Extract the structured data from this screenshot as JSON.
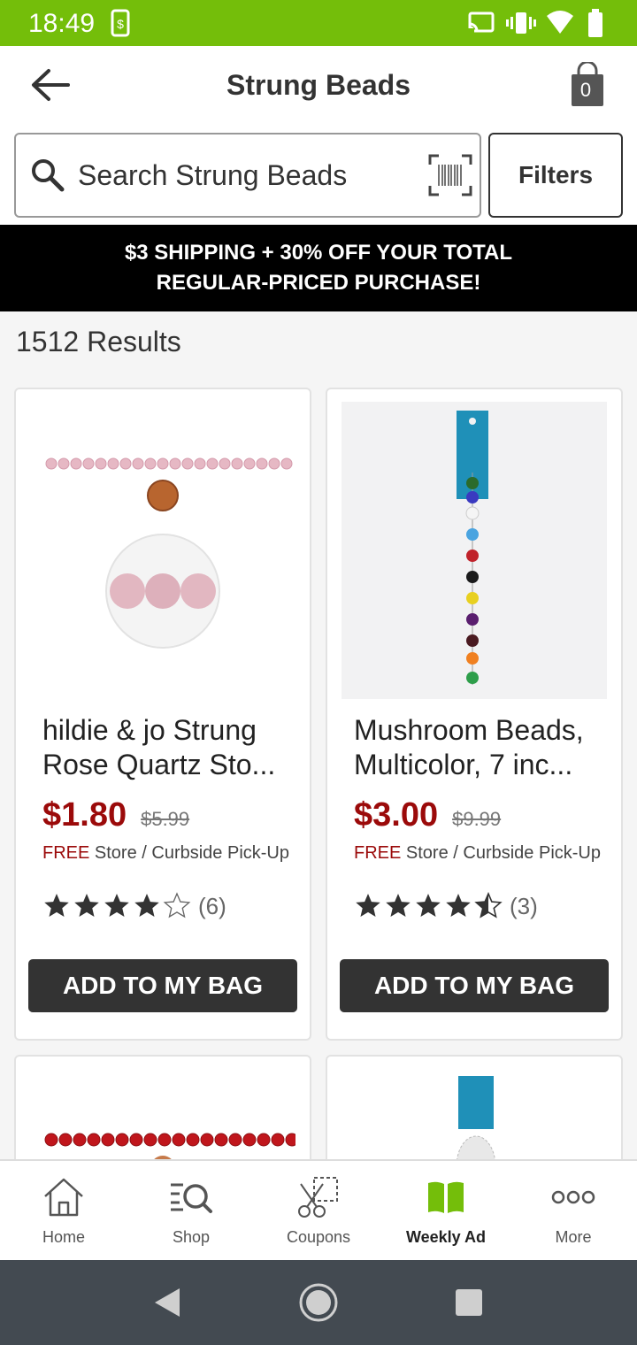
{
  "status_bar": {
    "time": "18:49"
  },
  "header": {
    "title": "Strung Beads",
    "bag_count": "0"
  },
  "search": {
    "placeholder": "Search Strung Beads",
    "filters_label": "Filters"
  },
  "promo": {
    "line1": "$3 SHIPPING + 30% OFF YOUR TOTAL",
    "line2": "REGULAR-PRICED PURCHASE!"
  },
  "results": {
    "count": "1512",
    "label": "Results"
  },
  "products": [
    {
      "name": "hildie & jo Strung Rose Quartz Sto...",
      "sale_price": "$1.80",
      "original_price": "$5.99",
      "pickup_free": "FREE",
      "pickup_text": "Store / Curbside Pick-Up",
      "rating": 4,
      "review_count": "(6)",
      "button_label": "ADD TO MY BAG"
    },
    {
      "name": "Mushroom Beads, Multicolor, 7 inc...",
      "sale_price": "$3.00",
      "original_price": "$9.99",
      "pickup_free": "FREE",
      "pickup_text": "Store / Curbside Pick-Up",
      "rating": 4.5,
      "review_count": "(3)",
      "button_label": "ADD TO MY BAG"
    }
  ],
  "bottom_nav": [
    {
      "label": "Home",
      "icon": "home-icon"
    },
    {
      "label": "Shop",
      "icon": "shop-search-icon"
    },
    {
      "label": "Coupons",
      "icon": "coupon-scissors-icon"
    },
    {
      "label": "Weekly Ad",
      "icon": "weekly-ad-book-icon",
      "active": true
    },
    {
      "label": "More",
      "icon": "more-dots-icon"
    }
  ],
  "colors": {
    "status_bar": "#74be0a",
    "accent_green": "#74be0a",
    "sale_red": "#9b0a0a",
    "button_dark": "#333333",
    "system_nav": "#434a51"
  }
}
